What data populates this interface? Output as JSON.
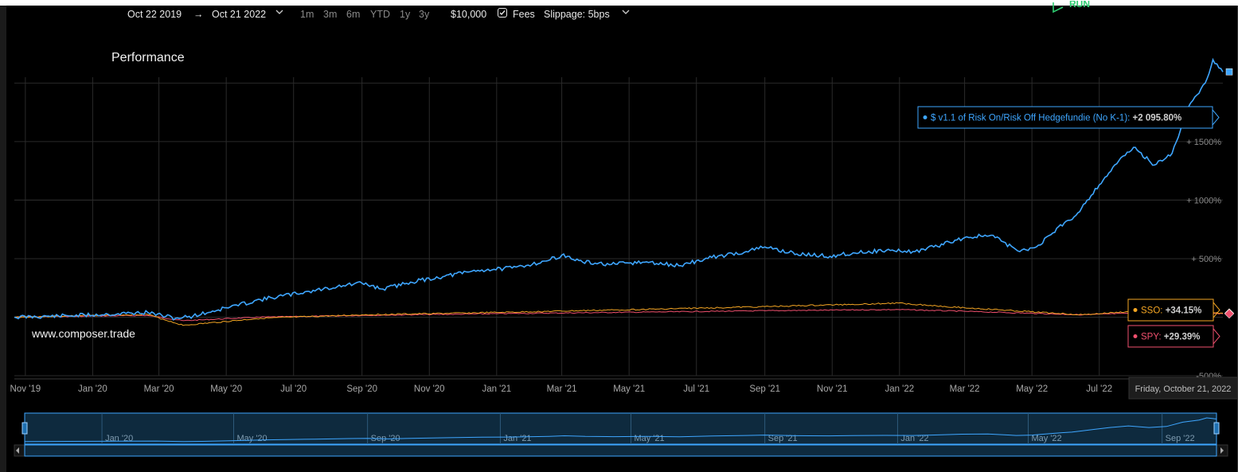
{
  "toolbar": {
    "start_date": "Oct 22 2019",
    "arrow": "→",
    "end_date": "Oct 21 2022",
    "ranges": [
      "1m",
      "3m",
      "6m",
      "YTD",
      "1y",
      "3y"
    ],
    "capital": "$10,000",
    "fees_label": "Fees",
    "fees_checked": true,
    "slippage": "Slippage: 5bps",
    "run_label": "RUN"
  },
  "title": "Performance",
  "watermark": "www.composer.trade",
  "colors": {
    "strategy": "#3ea6ff",
    "sso": "#f5a623",
    "spy": "#f0506e",
    "run": "#2ecc71"
  },
  "chart_data": {
    "type": "line",
    "title": "Performance",
    "xlabel": "",
    "ylabel": "",
    "x_range": [
      "2019-10-22",
      "2022-10-21"
    ],
    "ylim": [
      -500,
      2050
    ],
    "y_ticks": [
      {
        "value": 1500,
        "label": "+ 1500%"
      },
      {
        "value": 1000,
        "label": "+ 1000%"
      },
      {
        "value": 500,
        "label": "+ 500%"
      },
      {
        "value": -500,
        "label": "-500%"
      }
    ],
    "x_ticks": [
      {
        "date": "2019-11-01",
        "label": "Nov '19"
      },
      {
        "date": "2020-01-01",
        "label": "Jan '20"
      },
      {
        "date": "2020-03-01",
        "label": "Mar '20"
      },
      {
        "date": "2020-05-01",
        "label": "May '20"
      },
      {
        "date": "2020-07-01",
        "label": "Jul '20"
      },
      {
        "date": "2020-09-01",
        "label": "Sep '20"
      },
      {
        "date": "2020-11-01",
        "label": "Nov '20"
      },
      {
        "date": "2021-01-01",
        "label": "Jan '21"
      },
      {
        "date": "2021-03-01",
        "label": "Mar '21"
      },
      {
        "date": "2021-05-01",
        "label": "May '21"
      },
      {
        "date": "2021-07-01",
        "label": "Jul '21"
      },
      {
        "date": "2021-09-01",
        "label": "Sep '21"
      },
      {
        "date": "2021-11-01",
        "label": "Nov '21"
      },
      {
        "date": "2022-01-01",
        "label": "Jan '22"
      },
      {
        "date": "2022-03-01",
        "label": "Mar '22"
      },
      {
        "date": "2022-05-01",
        "label": "May '22"
      },
      {
        "date": "2022-07-01",
        "label": "Jul '22"
      }
    ],
    "grid": true,
    "crosshair_label": "Friday, October 21, 2022",
    "series": [
      {
        "key": "strategy",
        "name": "$ v1.1 of Risk On/Risk Off Hedgefundie (No K-1)",
        "final_label": "+2 095.80%",
        "points": [
          [
            "2019-10-22",
            0
          ],
          [
            "2019-12-01",
            10
          ],
          [
            "2020-01-15",
            25
          ],
          [
            "2020-02-20",
            40
          ],
          [
            "2020-03-16",
            -10
          ],
          [
            "2020-04-01",
            10
          ],
          [
            "2020-05-01",
            80
          ],
          [
            "2020-06-01",
            150
          ],
          [
            "2020-07-15",
            220
          ],
          [
            "2020-08-15",
            270
          ],
          [
            "2020-09-01",
            290
          ],
          [
            "2020-09-20",
            240
          ],
          [
            "2020-10-15",
            300
          ],
          [
            "2020-11-15",
            350
          ],
          [
            "2020-12-15",
            400
          ],
          [
            "2021-01-15",
            420
          ],
          [
            "2021-02-15",
            480
          ],
          [
            "2021-03-01",
            530
          ],
          [
            "2021-03-20",
            470
          ],
          [
            "2021-04-15",
            450
          ],
          [
            "2021-05-15",
            470
          ],
          [
            "2021-06-15",
            440
          ],
          [
            "2021-07-15",
            510
          ],
          [
            "2021-08-15",
            560
          ],
          [
            "2021-09-01",
            600
          ],
          [
            "2021-09-30",
            540
          ],
          [
            "2021-10-30",
            520
          ],
          [
            "2021-11-20",
            550
          ],
          [
            "2021-12-20",
            570
          ],
          [
            "2022-01-15",
            560
          ],
          [
            "2022-02-01",
            600
          ],
          [
            "2022-03-01",
            680
          ],
          [
            "2022-03-25",
            700
          ],
          [
            "2022-04-20",
            560
          ],
          [
            "2022-05-05",
            600
          ],
          [
            "2022-05-20",
            720
          ],
          [
            "2022-06-01",
            820
          ],
          [
            "2022-06-10",
            870
          ],
          [
            "2022-06-20",
            1000
          ],
          [
            "2022-07-01",
            1130
          ],
          [
            "2022-07-15",
            1300
          ],
          [
            "2022-08-01",
            1450
          ],
          [
            "2022-08-20",
            1300
          ],
          [
            "2022-09-05",
            1400
          ],
          [
            "2022-09-20",
            1800
          ],
          [
            "2022-10-05",
            2000
          ],
          [
            "2022-10-12",
            2200
          ],
          [
            "2022-10-21",
            2095.8
          ]
        ]
      },
      {
        "key": "sso",
        "name": "SSO",
        "final_label": "+34.15%",
        "points": [
          [
            "2019-10-22",
            0
          ],
          [
            "2020-02-19",
            25
          ],
          [
            "2020-03-23",
            -70
          ],
          [
            "2020-06-01",
            -10
          ],
          [
            "2020-09-01",
            20
          ],
          [
            "2021-01-01",
            40
          ],
          [
            "2021-06-01",
            70
          ],
          [
            "2021-09-01",
            90
          ],
          [
            "2021-12-31",
            120
          ],
          [
            "2022-03-01",
            80
          ],
          [
            "2022-06-16",
            20
          ],
          [
            "2022-08-16",
            60
          ],
          [
            "2022-10-21",
            34.15
          ]
        ]
      },
      {
        "key": "spy",
        "name": "SPY",
        "final_label": "+29.39%",
        "points": [
          [
            "2019-10-22",
            0
          ],
          [
            "2020-02-19",
            15
          ],
          [
            "2020-03-23",
            -30
          ],
          [
            "2020-06-01",
            0
          ],
          [
            "2020-09-01",
            15
          ],
          [
            "2021-01-01",
            30
          ],
          [
            "2021-06-01",
            45
          ],
          [
            "2021-09-01",
            55
          ],
          [
            "2021-12-31",
            65
          ],
          [
            "2022-03-01",
            50
          ],
          [
            "2022-06-16",
            20
          ],
          [
            "2022-08-16",
            40
          ],
          [
            "2022-10-21",
            29.39
          ]
        ]
      }
    ],
    "navigator": {
      "labels": [
        {
          "date": "2020-01-01",
          "label": "Jan '20"
        },
        {
          "date": "2020-05-01",
          "label": "May '20"
        },
        {
          "date": "2020-09-01",
          "label": "Sep '20"
        },
        {
          "date": "2021-01-01",
          "label": "Jan '21"
        },
        {
          "date": "2021-05-01",
          "label": "May '21"
        },
        {
          "date": "2021-09-01",
          "label": "Sep '21"
        },
        {
          "date": "2022-01-01",
          "label": "Jan '22"
        },
        {
          "date": "2022-05-01",
          "label": "May '22"
        },
        {
          "date": "2022-09-01",
          "label": "Sep '22"
        }
      ]
    }
  }
}
